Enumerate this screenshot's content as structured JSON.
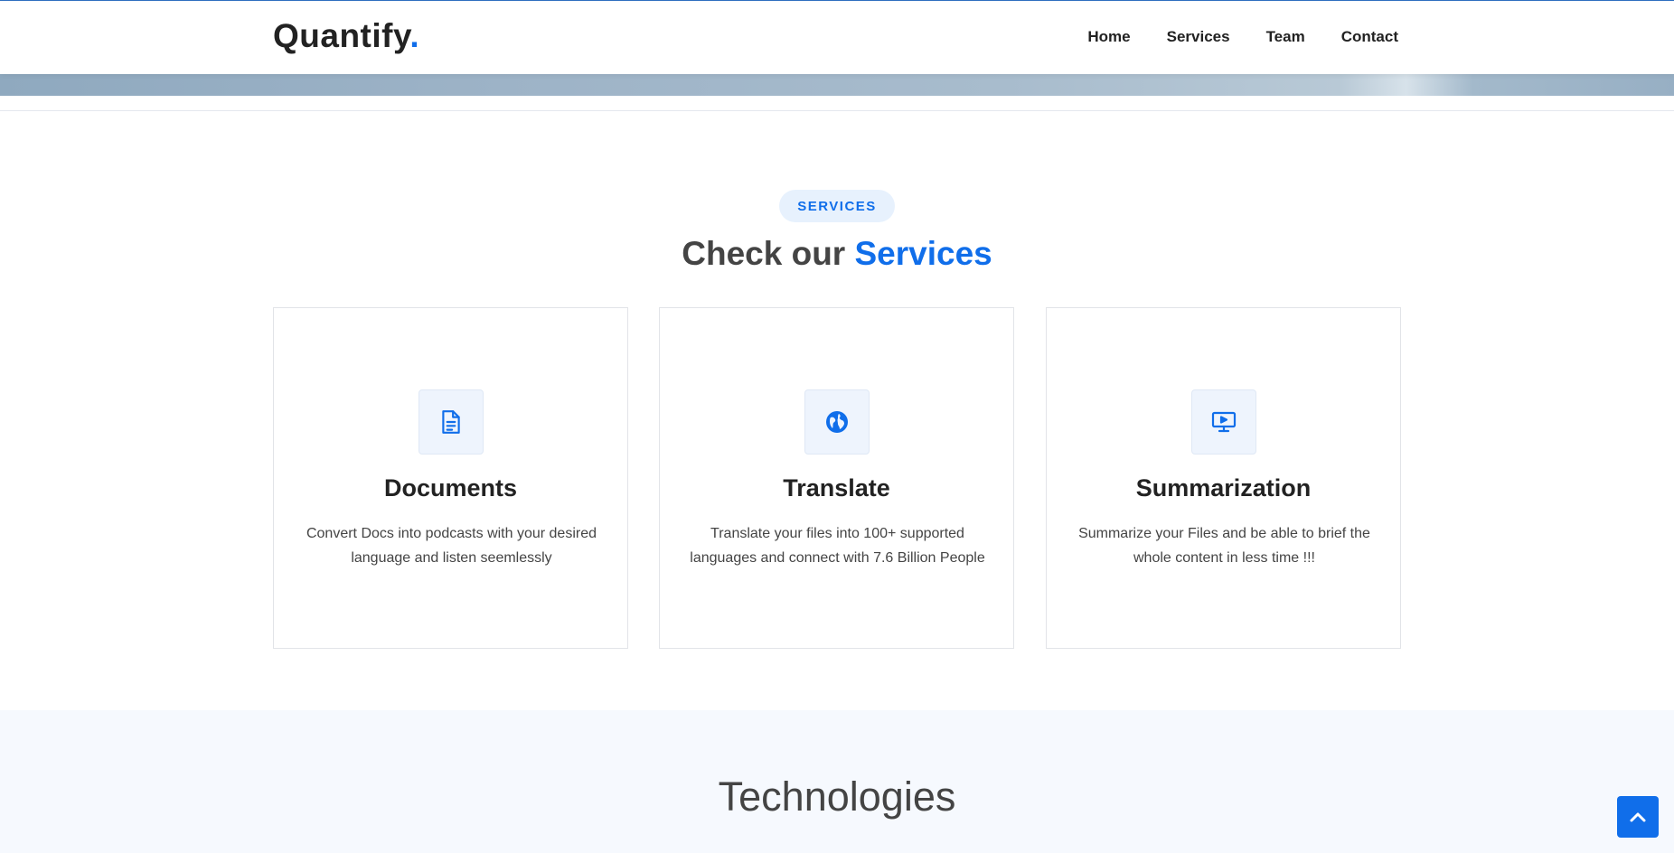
{
  "header": {
    "logo_text": "Quantify",
    "logo_dot": ".",
    "nav": [
      "Home",
      "Services",
      "Team",
      "Contact"
    ]
  },
  "services": {
    "badge": "SERVICES",
    "title_prefix": "Check our",
    "title_accent": "Services",
    "cards": [
      {
        "icon": "document-icon",
        "title": "Documents",
        "description": "Convert Docs into podcasts with your desired language and listen seemlessly"
      },
      {
        "icon": "globe-icon",
        "title": "Translate",
        "description": "Translate your files into 100+ supported languages and connect with 7.6 Billion People"
      },
      {
        "icon": "presentation-icon",
        "title": "Summarization",
        "description": "Summarize your Files and be able to brief the whole content in less time !!!"
      }
    ]
  },
  "technologies": {
    "title": "Technologies"
  },
  "back_to_top": {
    "icon": "chevron-up-icon"
  },
  "colors": {
    "accent": "#106eea",
    "text_dark": "#222222",
    "text_body": "#444444",
    "badge_bg": "#e7f1fd",
    "tech_bg": "#f6f9fe"
  }
}
